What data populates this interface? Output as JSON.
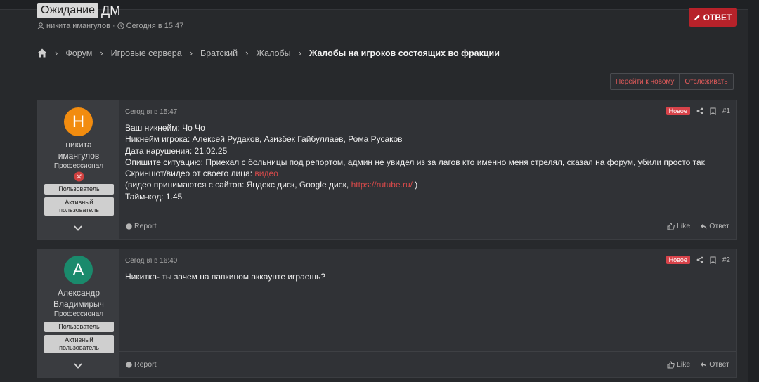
{
  "thread": {
    "prefix": "Ожидание",
    "title": "ДМ",
    "author": "никита имангулов",
    "sep": "·",
    "date": "Сегодня в 15:47",
    "reply_label": "ОТВЕТ"
  },
  "breadcrumb": [
    "Форум",
    "Игровые сервера",
    "Братский",
    "Жалобы",
    "Жалобы на игроков состоящих во фракции"
  ],
  "thread_actions": {
    "go_new": "Перейти к новому",
    "watch": "Отслеживать"
  },
  "posts": [
    {
      "avatar_letter": "Н",
      "avatar_color": "#f28c0f",
      "username_l1": "никита",
      "username_l2": "имангулов",
      "user_title": "Профессионал",
      "badge1": "Пользователь",
      "badge2_l1": "Активный",
      "badge2_l2": "пользователь",
      "date": "Сегодня в 15:47",
      "new": "Новое",
      "number": "#1",
      "lines": {
        "l1": "Ваш никнейм: Чо Чо",
        "l2": "Никнейм игрока: Алексей Рудаков, Азизбек Гайбуллаев, Рома Русаков",
        "l3": "Дата нарушения: 21.02.25",
        "l4": "Опишите ситуацию: Приехал с больницы под репортом, админ не увидел из за лагов кто именно меня стрелял, сказал на форум, убили просто так",
        "l5_text": "Скриншот/видео от своего лица: ",
        "l5_link": "видео",
        "l6_text": "(видео принимаются с сайтов: Яндекс диск, Google диск, ",
        "l6_link": "https://rutube.ru/",
        "l6_end": " )",
        "l7": "Тайм-код: 1.45"
      },
      "report": "Report",
      "like": "Like",
      "reply": "Ответ"
    },
    {
      "avatar_letter": "А",
      "avatar_color": "#1a8a6c",
      "username_l1": "Александр",
      "username_l2": "Владимирыч",
      "user_title": "Профессионал",
      "badge1": "Пользователь",
      "badge2_l1": "Активный",
      "badge2_l2": "пользователь",
      "date": "Сегодня в 16:40",
      "new": "Новое",
      "number": "#2",
      "text": "Никитка- ты зачем на папкином аккаунте играешь?",
      "report": "Report",
      "like": "Like",
      "reply": "Ответ"
    }
  ]
}
